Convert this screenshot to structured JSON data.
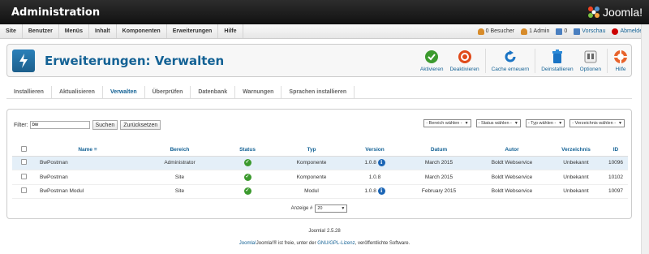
{
  "app": {
    "title": "Administration",
    "logo_text": "Joomla!"
  },
  "menu": [
    "Site",
    "Benutzer",
    "Menüs",
    "Inhalt",
    "Komponenten",
    "Erweiterungen",
    "Hilfe"
  ],
  "status": {
    "visitors": "0 Besucher",
    "admins": "1 Admin",
    "messages": "0",
    "preview": "Vorschau",
    "logout": "Abmelden"
  },
  "page": {
    "title": "Erweiterungen: Verwalten"
  },
  "toolbar": {
    "activate": "Aktivieren",
    "deactivate": "Deaktivieren",
    "refresh_cache": "Cache erneuern",
    "uninstall": "Deinstallieren",
    "options": "Optionen",
    "help": "Hilfe"
  },
  "tabs": [
    {
      "label": "Installieren",
      "active": false
    },
    {
      "label": "Aktualisieren",
      "active": false
    },
    {
      "label": "Verwalten",
      "active": true
    },
    {
      "label": "Überprüfen",
      "active": false
    },
    {
      "label": "Datenbank",
      "active": false
    },
    {
      "label": "Warnungen",
      "active": false
    },
    {
      "label": "Sprachen installieren",
      "active": false
    }
  ],
  "filter": {
    "label": "Filter:",
    "value": "bw",
    "search_button": "Suchen",
    "reset_button": "Zurücksetzen"
  },
  "selects": {
    "area": "- Bereich wählen -",
    "status": "- Status wählen -",
    "type": "- Typ wählen -",
    "directory": "- Verzeichnis wählen -"
  },
  "table": {
    "headers": {
      "name": "Name",
      "area": "Bereich",
      "status": "Status",
      "type": "Typ",
      "version": "Version",
      "date": "Datum",
      "author": "Autor",
      "directory": "Verzeichnis",
      "id": "ID"
    },
    "rows": [
      {
        "name": "BwPostman",
        "area": "Administrator",
        "type": "Komponente",
        "version": "1.0.8",
        "date": "March 2015",
        "author": "Boldt Webservice",
        "directory": "Unbekannt",
        "id": "10096",
        "has_info": true
      },
      {
        "name": "BwPostman",
        "area": "Site",
        "type": "Komponente",
        "version": "1.0.8",
        "date": "March 2015",
        "author": "Boldt Webservice",
        "directory": "Unbekannt",
        "id": "10102",
        "has_info": false
      },
      {
        "name": "BwPostman Modul",
        "area": "Site",
        "type": "Modul",
        "version": "1.0.8",
        "date": "February 2015",
        "author": "Boldt Webservice",
        "directory": "Unbekannt",
        "id": "10097",
        "has_info": true
      }
    ]
  },
  "pager": {
    "label": "Anzeige #",
    "value": "20"
  },
  "footer": {
    "version": "Joomla! 2.5.28",
    "license_pre": "Joomla!® ist freie, unter der",
    "license_link": "GNU/GPL-Lizenz",
    "license_post": "veröffentlichte Software."
  },
  "colors": {
    "brand": "#146295",
    "header": "#1b1b1b",
    "selected_row": "#e4eff8"
  }
}
